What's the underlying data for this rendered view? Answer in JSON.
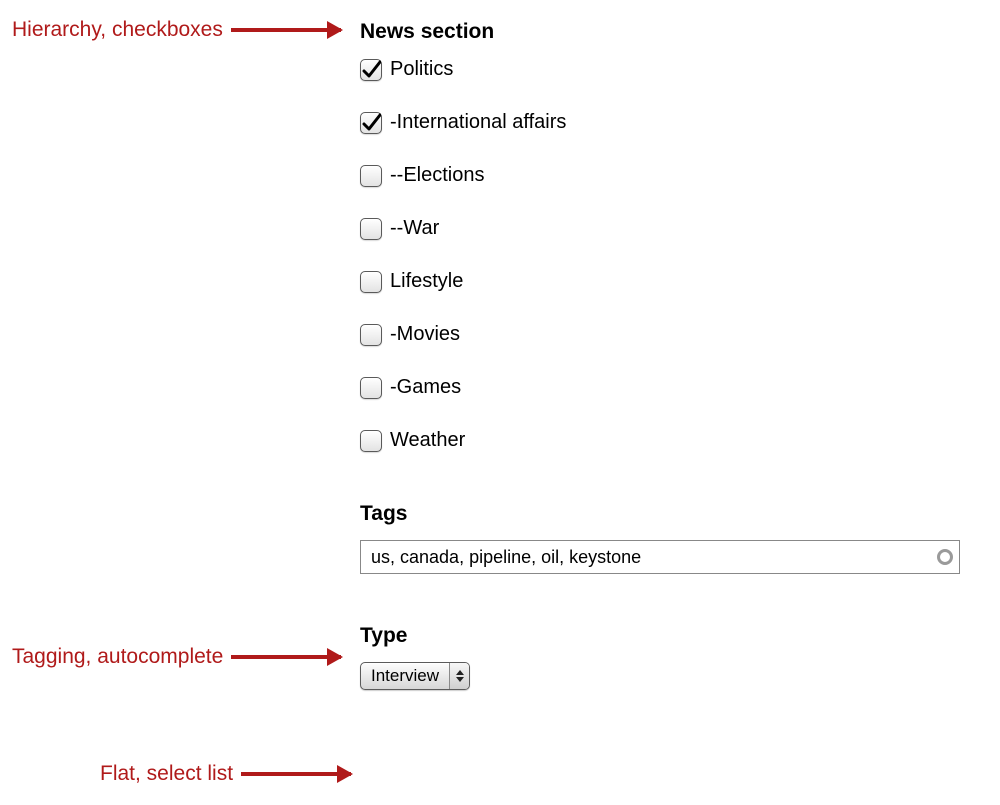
{
  "annotations": {
    "hierarchy": "Hierarchy, checkboxes",
    "tagging": "Tagging, autocomplete",
    "flat": "Flat, select list"
  },
  "news": {
    "heading": "News section",
    "items": [
      {
        "label": "Politics",
        "checked": true
      },
      {
        "label": "-International affairs",
        "checked": true
      },
      {
        "label": "--Elections",
        "checked": false
      },
      {
        "label": "--War",
        "checked": false
      },
      {
        "label": "Lifestyle",
        "checked": false
      },
      {
        "label": "-Movies",
        "checked": false
      },
      {
        "label": "-Games",
        "checked": false
      },
      {
        "label": "Weather",
        "checked": false
      }
    ]
  },
  "tags": {
    "heading": "Tags",
    "value": "us, canada, pipeline, oil, keystone"
  },
  "type": {
    "heading": "Type",
    "selected": "Interview"
  }
}
